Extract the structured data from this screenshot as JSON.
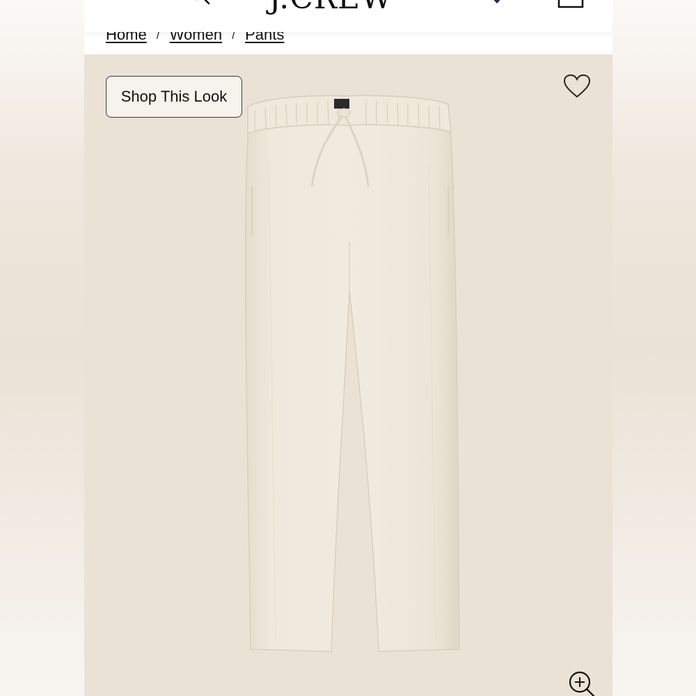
{
  "header": {
    "logo": "J.CREW",
    "icons": [
      "menu-icon",
      "search-icon",
      "favorites-icon",
      "bag-icon"
    ]
  },
  "breadcrumb": {
    "items": [
      {
        "label": "Home"
      },
      {
        "label": "Women"
      },
      {
        "label": "Pants"
      }
    ],
    "separator": "/"
  },
  "product": {
    "shop_look_label": "Shop This Look",
    "icons": [
      "heart-icon",
      "zoom-icon"
    ]
  },
  "colors": {
    "product_bg": "#ebe2d6",
    "pants_fabric": "#eee7d9",
    "text": "#111111",
    "accent_navy": "#1f2f5e"
  }
}
